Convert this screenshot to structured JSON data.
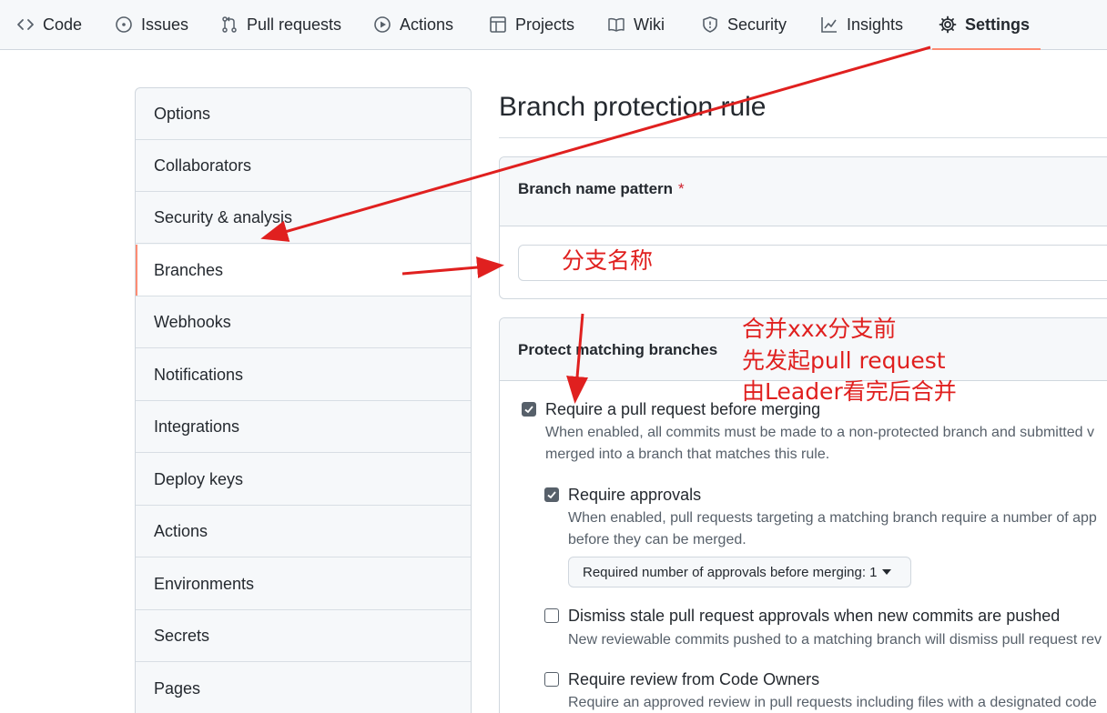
{
  "repo_nav": {
    "tabs": [
      {
        "label": "Code",
        "icon": "code-icon"
      },
      {
        "label": "Issues",
        "icon": "issue-opened-icon"
      },
      {
        "label": "Pull requests",
        "icon": "git-pull-request-icon"
      },
      {
        "label": "Actions",
        "icon": "play-icon"
      },
      {
        "label": "Projects",
        "icon": "table-icon"
      },
      {
        "label": "Wiki",
        "icon": "book-icon"
      },
      {
        "label": "Security",
        "icon": "shield-icon"
      },
      {
        "label": "Insights",
        "icon": "graph-icon"
      },
      {
        "label": "Settings",
        "icon": "gear-icon",
        "active": true
      }
    ],
    "active_underline_color": "#fd8c73"
  },
  "sidebar": {
    "items": [
      {
        "label": "Options"
      },
      {
        "label": "Collaborators"
      },
      {
        "label": "Security & analysis"
      },
      {
        "label": "Branches",
        "selected": true
      },
      {
        "label": "Webhooks"
      },
      {
        "label": "Notifications"
      },
      {
        "label": "Integrations"
      },
      {
        "label": "Deploy keys"
      },
      {
        "label": "Actions"
      },
      {
        "label": "Environments"
      },
      {
        "label": "Secrets"
      },
      {
        "label": "Pages"
      }
    ]
  },
  "main": {
    "title": "Branch protection rule",
    "pattern_box": {
      "label": "Branch name pattern",
      "required_mark": "*",
      "input_value": ""
    },
    "protect_box": {
      "label": "Protect matching branches",
      "options": [
        {
          "label": "Require a pull request before merging",
          "checked": true,
          "desc_lines": [
            "When enabled, all commits must be made to a non-protected branch and submitted v",
            "merged into a branch that matches this rule."
          ]
        },
        {
          "label": "Require approvals",
          "checked": true,
          "desc_lines": [
            "When enabled, pull requests targeting a matching branch require a number of app",
            "before they can be merged."
          ],
          "select": {
            "label": "Required number of approvals before merging: 1"
          }
        },
        {
          "label": "Dismiss stale pull request approvals when new commits are pushed",
          "checked": false,
          "desc_lines": [
            "New reviewable commits pushed to a matching branch will dismiss pull request rev"
          ]
        },
        {
          "label": "Require review from Code Owners",
          "checked": false,
          "desc_lines": [
            "Require an approved review in pull requests including files with a designated code"
          ]
        }
      ]
    }
  },
  "annotations": {
    "branch_name_note": "分支名称",
    "merge_note_lines": [
      "合并xxx分支前",
      "先发起pull request",
      "由Leader看完后合并"
    ],
    "color": "#e0201f"
  }
}
